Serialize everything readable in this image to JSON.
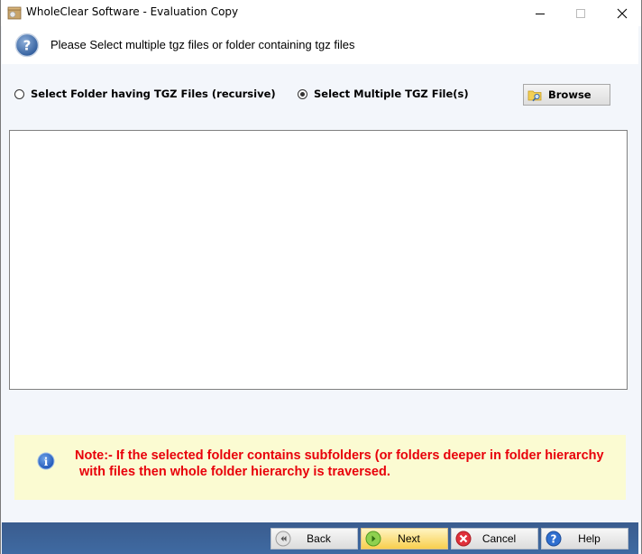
{
  "window": {
    "title": "WholeClear Software - Evaluation Copy",
    "controls": {
      "minimize_icon": "minimize-icon",
      "maximize_icon": "maximize-icon",
      "close_icon": "close-icon"
    }
  },
  "header": {
    "icon": "question-icon",
    "text": "Please Select multiple tgz files or folder containing tgz files"
  },
  "options": {
    "folder_option": {
      "label": "Select Folder having TGZ Files (recursive)",
      "checked": false
    },
    "files_option": {
      "label": "Select Multiple TGZ File(s)",
      "checked": true
    },
    "browse_label": "Browse",
    "browse_icon": "folder-search-icon"
  },
  "file_list": {
    "items": []
  },
  "note": {
    "icon": "info-icon",
    "line1": "Note:- If the selected folder contains subfolders (or folders deeper in folder hierarchy",
    "line2": "with files then whole folder hierarchy is traversed."
  },
  "footer": {
    "back_label": "Back",
    "next_label": "Next",
    "cancel_label": "Cancel",
    "help_label": "Help"
  },
  "colors": {
    "note_text": "#e8000a",
    "note_bg": "#fbfbd2",
    "footer_bg": "#3f6aa2",
    "next_button": "#f8cf4e"
  }
}
